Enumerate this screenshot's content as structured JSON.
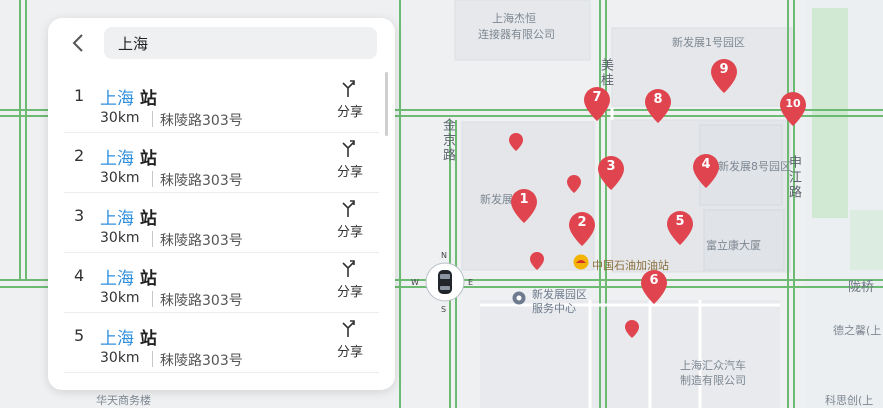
{
  "search": {
    "back_label": "<",
    "query": "上海"
  },
  "results": [
    {
      "index": "1",
      "name_highlight": "上海",
      "name_rest": " 站",
      "distance": "30km",
      "address": "秣陵路303号",
      "share_label": "分享"
    },
    {
      "index": "2",
      "name_highlight": "上海",
      "name_rest": " 站",
      "distance": "30km",
      "address": "秣陵路303号",
      "share_label": "分享"
    },
    {
      "index": "3",
      "name_highlight": "上海",
      "name_rest": " 站",
      "distance": "30km",
      "address": "秣陵路303号",
      "share_label": "分享"
    },
    {
      "index": "4",
      "name_highlight": "上海",
      "name_rest": " 站",
      "distance": "30km",
      "address": "秣陵路303号",
      "share_label": "分享"
    },
    {
      "index": "5",
      "name_highlight": "上海",
      "name_rest": " 站",
      "distance": "30km",
      "address": "秣陵路303号",
      "share_label": "分享"
    }
  ],
  "map": {
    "labels": {
      "shanghai_jiechu": "上海杰恒",
      "connector_co": "连接器有限公司",
      "xinfazhan_1": "新发展1号园区",
      "xinfazhan_park": "新发展园区",
      "xinfazhan_8": "新发展8号园区",
      "fulikang": "富立康大厦",
      "petrochina": "中国石油加油站",
      "service_center_1": "新发展园区",
      "service_center_2": "服务中心",
      "huizhong_1": "上海汇众汽车",
      "huizhong_2": "制造有限公司",
      "dezhixin": "德之馨(上",
      "kesi": "科思创(上",
      "huahua": "华天商务楼",
      "luqiao": "陇桥"
    },
    "roads": {
      "jinjing": "金京路",
      "meigui": "美桂",
      "shenjiang": "申江路"
    },
    "markers": [
      "1",
      "2",
      "3",
      "4",
      "5",
      "6",
      "7",
      "8",
      "9",
      "10"
    ],
    "compass": {
      "n": "N",
      "s": "S",
      "e": "E",
      "w": "W"
    },
    "colors": {
      "marker": "#e0454f",
      "road": "#6dbb73",
      "poi_text": "#6c7a8c"
    }
  }
}
